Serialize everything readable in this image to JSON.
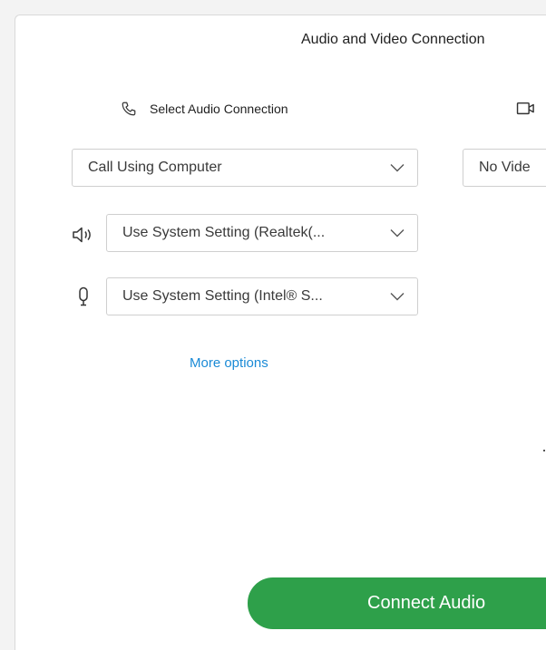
{
  "dialog": {
    "title": "Audio and Video Connection"
  },
  "audio": {
    "heading": "Select Audio Connection",
    "heading_icon": "phone-icon",
    "connection_value": "Call Using Computer",
    "speaker_icon": "speaker-icon",
    "speaker_value": "Use System Setting (Realtek(...",
    "microphone_icon": "microphone-icon",
    "microphone_value": "Use System Setting (Intel® S...",
    "more_options_label": "More options"
  },
  "video": {
    "heading_icon": "video-camera-icon",
    "connection_value": "No Vide"
  },
  "actions": {
    "connect_label": "Connect Audio"
  },
  "colors": {
    "accent_link": "#1a8ad6",
    "connect_button": "#2ea04a"
  }
}
